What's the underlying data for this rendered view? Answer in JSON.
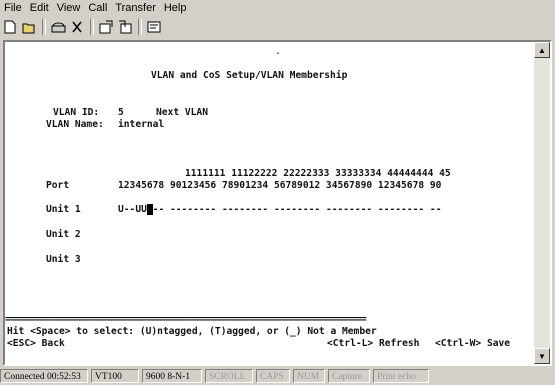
{
  "menu": [
    "File",
    "Edit",
    "View",
    "Call",
    "Transfer",
    "Help"
  ],
  "toolbar_icons": [
    "new-icon",
    "open-icon",
    "phone-icon",
    "disconnect-icon",
    "send-icon",
    "receive-icon",
    "properties-icon"
  ],
  "terminal": {
    "title": "VLAN and CoS Setup/VLAN Membership",
    "vlan_id_label": "VLAN ID:",
    "vlan_id_value": "5",
    "next_vlan": "Next VLAN",
    "vlan_name_label": "VLAN Name:",
    "vlan_name_value": "internal",
    "port_header_top": "1111111 11122222 22222333 33333334 44444444 45",
    "port_label": "Port",
    "port_header_bottom": "12345678 90123456 78901234 56789012 34567890 12345678 90",
    "units": [
      {
        "label": "Unit 1",
        "before_cursor": "U--UU",
        "cursor": "U",
        "after_cursor": "-- -------- -------- -------- -------- -------- --"
      },
      {
        "label": "Unit 2"
      },
      {
        "label": "Unit 3"
      }
    ],
    "divider": "==========================================================================",
    "help_line": "Hit <Space> to select: (U)ntagged, (T)agged, or (_) Not a Member",
    "esc_label": "<ESC> Back",
    "refresh_label": "<Ctrl-L> Refresh",
    "save_label": "<Ctrl-W> Save",
    "top_marker": "-"
  },
  "status": {
    "connected": "Connected 00:52:53",
    "emulation": "VT100",
    "settings": "9600 8-N-1",
    "scroll": "SCROLL",
    "caps": "CAPS",
    "num": "NUM",
    "capture": "Capture",
    "printecho": "Print echo"
  }
}
